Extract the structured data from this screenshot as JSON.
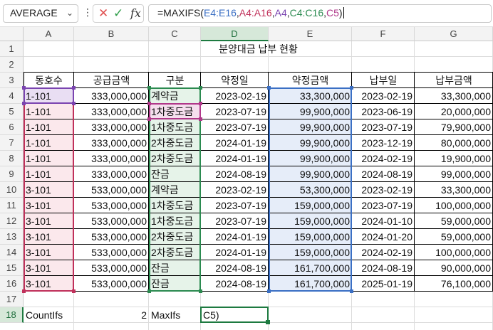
{
  "formula_bar": {
    "name_box": "AVERAGE",
    "cancel_glyph": "✕",
    "enter_glyph": "✓",
    "fx_label": "fx",
    "formula_parts": [
      {
        "text": "=MAXIFS(",
        "color": "#222222"
      },
      {
        "text": "E4:E16",
        "color": "#3a6fc4"
      },
      {
        "text": ",",
        "color": "#222222"
      },
      {
        "text": "A4:A16",
        "color": "#c0305a"
      },
      {
        "text": ",",
        "color": "#222222"
      },
      {
        "text": "A4",
        "color": "#7a44b0"
      },
      {
        "text": ",",
        "color": "#222222"
      },
      {
        "text": "C4:C16",
        "color": "#2b8a50"
      },
      {
        "text": ",",
        "color": "#222222"
      },
      {
        "text": "C5",
        "color": "#b0388a"
      },
      {
        "text": ")",
        "color": "#222222"
      }
    ]
  },
  "columns": [
    "A",
    "B",
    "C",
    "D",
    "E",
    "F",
    "G"
  ],
  "selected_column": "D",
  "selected_row": "18",
  "rows": [
    {
      "num": "1",
      "cells": [
        "",
        "",
        "",
        "분양대금 납부 현황",
        "",
        "",
        ""
      ]
    },
    {
      "num": "2",
      "cells": [
        "",
        "",
        "",
        "",
        "",
        "",
        ""
      ]
    },
    {
      "num": "3",
      "cells": [
        "동호수",
        "공급금액",
        "구분",
        "약정일",
        "약정금액",
        "납부일",
        "납부금액"
      ]
    },
    {
      "num": "4",
      "cells": [
        "1-101",
        "333,000,000",
        "계약금",
        "2023-02-19",
        "33,300,000",
        "2023-02-19",
        "33,300,000"
      ]
    },
    {
      "num": "5",
      "cells": [
        "1-101",
        "333,000,000",
        "1차중도금",
        "2023-07-19",
        "99,900,000",
        "2023-06-19",
        "20,000,000"
      ]
    },
    {
      "num": "6",
      "cells": [
        "1-101",
        "333,000,000",
        "1차중도금",
        "2023-07-19",
        "99,900,000",
        "2023-07-19",
        "79,900,000"
      ]
    },
    {
      "num": "7",
      "cells": [
        "1-101",
        "333,000,000",
        "2차중도금",
        "2024-01-19",
        "99,900,000",
        "2023-12-19",
        "80,000,000"
      ]
    },
    {
      "num": "8",
      "cells": [
        "1-101",
        "333,000,000",
        "2차중도금",
        "2024-01-19",
        "99,900,000",
        "2024-02-19",
        "19,900,000"
      ]
    },
    {
      "num": "9",
      "cells": [
        "1-101",
        "333,000,000",
        "잔금",
        "2024-08-19",
        "99,900,000",
        "2024-08-19",
        "99,000,000"
      ]
    },
    {
      "num": "10",
      "cells": [
        "3-101",
        "533,000,000",
        "계약금",
        "2023-02-19",
        "53,300,000",
        "2023-02-19",
        "33,300,000"
      ]
    },
    {
      "num": "11",
      "cells": [
        "3-101",
        "533,000,000",
        "1차중도금",
        "2023-07-19",
        "159,000,000",
        "2023-07-19",
        "100,000,000"
      ]
    },
    {
      "num": "12",
      "cells": [
        "3-101",
        "533,000,000",
        "1차중도금",
        "2023-07-19",
        "159,000,000",
        "2024-01-10",
        "59,000,000"
      ]
    },
    {
      "num": "13",
      "cells": [
        "3-101",
        "533,000,000",
        "2차중도금",
        "2024-01-19",
        "159,000,000",
        "2024-01-20",
        "59,000,000"
      ]
    },
    {
      "num": "14",
      "cells": [
        "3-101",
        "533,000,000",
        "2차중도금",
        "2024-01-19",
        "159,000,000",
        "2024-02-19",
        "100,000,000"
      ]
    },
    {
      "num": "15",
      "cells": [
        "3-101",
        "533,000,000",
        "잔금",
        "2024-08-19",
        "161,700,000",
        "2024-08-19",
        "90,000,000"
      ]
    },
    {
      "num": "16",
      "cells": [
        "3-101",
        "533,000,000",
        "잔금",
        "2024-08-19",
        "161,700,000",
        "2025-01-19",
        "76,100,000"
      ]
    },
    {
      "num": "17",
      "cells": [
        "",
        "",
        "",
        "",
        "",
        "",
        ""
      ]
    },
    {
      "num": "18",
      "cells": [
        "CountIfs",
        "2",
        "MaxIfs",
        "C5)",
        "",
        "",
        ""
      ]
    }
  ],
  "reference_colors": {
    "E4:E16": "#3a6fc4",
    "A4:A16": "#c0305a",
    "A4": "#7a44b0",
    "C4:C16": "#2b8a50",
    "C5": "#b0388a",
    "active_cell": "#1d7a40"
  }
}
